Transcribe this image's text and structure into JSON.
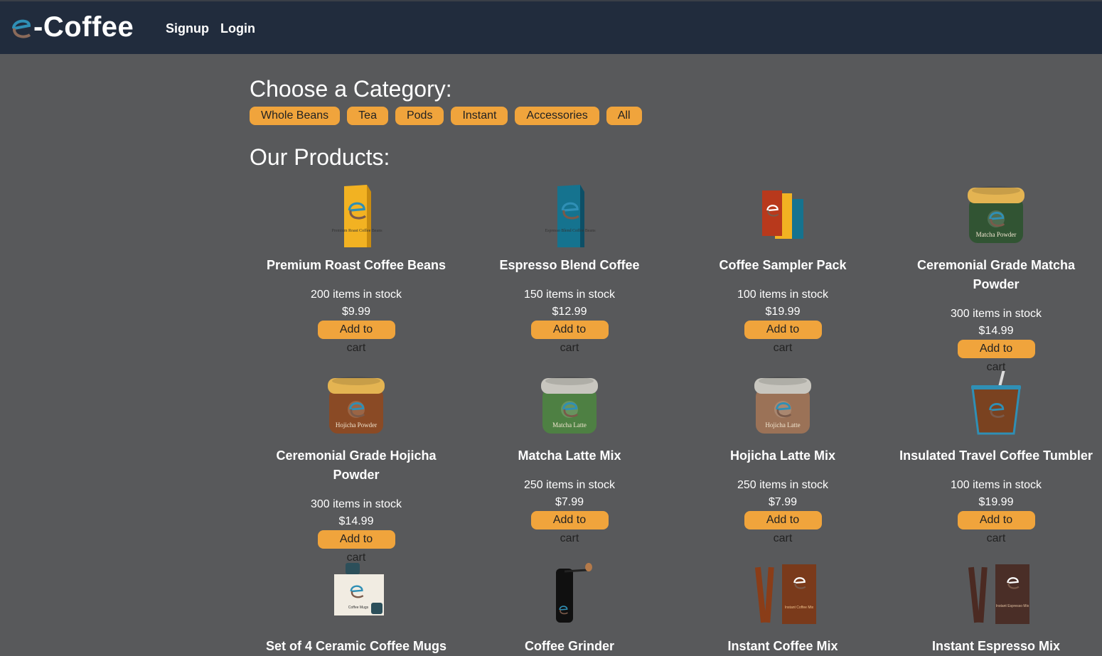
{
  "brand": {
    "logo_letter": "e",
    "name": "-Coffee"
  },
  "nav": {
    "signup": "Signup",
    "login": "Login"
  },
  "category_section": {
    "title": "Choose a Category:",
    "categories": [
      "Whole Beans",
      "Tea",
      "Pods",
      "Instant",
      "Accessories",
      "All"
    ]
  },
  "products_section": {
    "title": "Our Products:",
    "add_label": "Add to cart",
    "products": [
      {
        "name": "Premium Roast Coffee Beans",
        "stock": "200 items in stock",
        "price": "$9.99",
        "icon": "coffee-bag-yellow-icon",
        "package_text": "Premium Roast Coffee Beans"
      },
      {
        "name": "Espresso Blend Coffee",
        "stock": "150 items in stock",
        "price": "$12.99",
        "icon": "coffee-bag-blue-icon",
        "package_text": "Espresso Blend Coffee Beans"
      },
      {
        "name": "Coffee Sampler Pack",
        "stock": "100 items in stock",
        "price": "$19.99",
        "icon": "sampler-bags-icon"
      },
      {
        "name": "Ceremonial Grade Matcha Powder",
        "stock": "300 items in stock",
        "price": "$14.99",
        "icon": "matcha-jar-icon",
        "package_text": "Matcha Powder"
      },
      {
        "name": "Ceremonial Grade Hojicha Powder",
        "stock": "300 items in stock",
        "price": "$14.99",
        "icon": "hojicha-jar-icon",
        "package_text": "Hojicha Powder"
      },
      {
        "name": "Matcha Latte Mix",
        "stock": "250 items in stock",
        "price": "$7.99",
        "icon": "matcha-latte-jar-icon",
        "package_text": "Matcha Latte"
      },
      {
        "name": "Hojicha Latte Mix",
        "stock": "250 items in stock",
        "price": "$7.99",
        "icon": "hojicha-latte-jar-icon",
        "package_text": "Hojicha Latte"
      },
      {
        "name": "Insulated Travel Coffee Tumbler",
        "stock": "100 items in stock",
        "price": "$19.99",
        "icon": "tumbler-icon"
      },
      {
        "name": "Set of 4 Ceramic Coffee Mugs",
        "icon": "mug-box-icon",
        "package_text": "Coffee Mugs"
      },
      {
        "name": "Coffee Grinder",
        "icon": "grinder-icon"
      },
      {
        "name": "Instant Coffee Mix",
        "icon": "instant-coffee-box-icon",
        "package_text": "Instant Coffee Mix"
      },
      {
        "name": "Instant Espresso Mix",
        "icon": "instant-espresso-box-icon",
        "package_text": "Instant Espresso Mix"
      }
    ]
  },
  "colors": {
    "navbar": "#212c3d",
    "background": "#58595b",
    "accent": "#f0a43c",
    "logo_blue": "#2f8fb5"
  }
}
